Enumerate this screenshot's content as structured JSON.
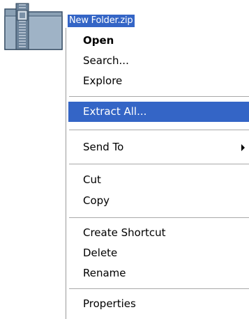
{
  "file": {
    "name": "New Folder.zip",
    "icon": "zip-folder-icon"
  },
  "colors": {
    "highlight": "#3465c6",
    "highlight_text": "#ffffff",
    "menu_bg": "#ffffff"
  },
  "menu": {
    "items": [
      {
        "label": "Open"
      },
      {
        "label": "Search..."
      },
      {
        "label": "Explore"
      },
      {
        "label": "Extract All..."
      },
      {
        "label": "Send To",
        "submenu_icon": "chevron-right-icon"
      },
      {
        "label": "Cut"
      },
      {
        "label": "Copy"
      },
      {
        "label": "Create Shortcut"
      },
      {
        "label": "Delete"
      },
      {
        "label": "Rename"
      },
      {
        "label": "Properties"
      }
    ]
  }
}
